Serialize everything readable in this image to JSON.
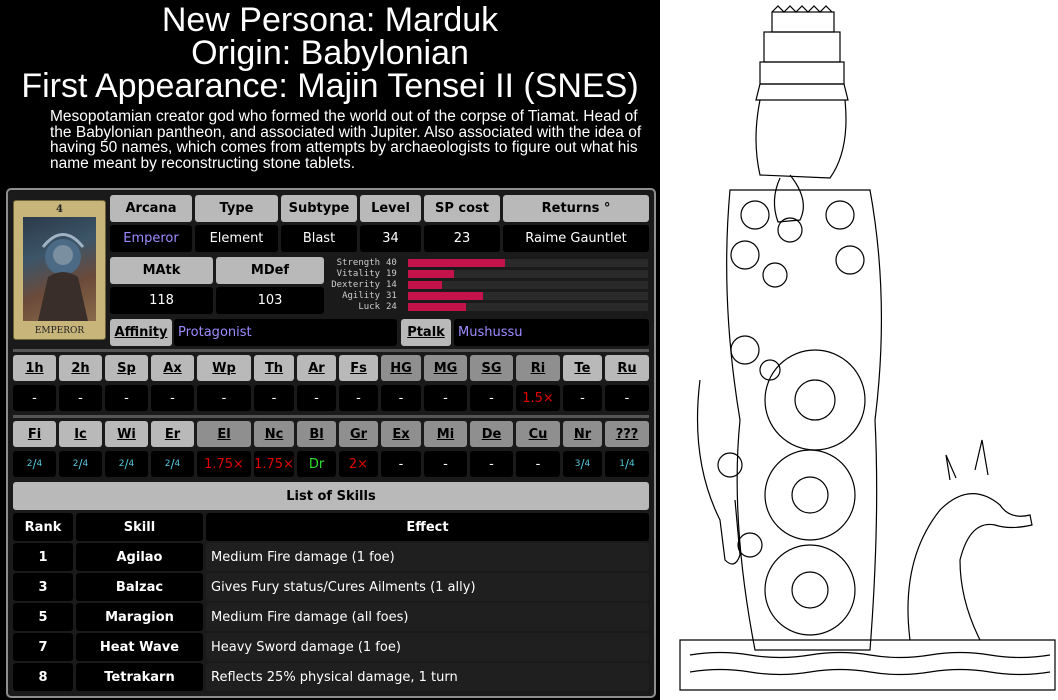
{
  "header": {
    "title": "New Persona: Marduk",
    "origin": "Origin: Babylonian",
    "first_appearance": "First Appearance: Majin Tensei II (SNES)",
    "description": "Mesopotamian creator god who formed the world out of the corpse of Tiamat. Head of the Babylonian pantheon, and associated with Jupiter. Also associated with the idea of having 50 names, which comes from attempts by archaeologists to figure out what his name meant by reconstructing stone tablets."
  },
  "card": {
    "number": "4",
    "label": "EMPEROR"
  },
  "info": {
    "headers": [
      "Arcana",
      "Type",
      "Subtype",
      "Level",
      "SP cost",
      "Returns °"
    ],
    "values": [
      "Emperor",
      "Element",
      "Blast",
      "34",
      "23",
      "Raime Gauntlet"
    ]
  },
  "combat": {
    "matk_label": "MAtk",
    "mdef_label": "MDef",
    "matk": "118",
    "mdef": "103"
  },
  "stats": [
    {
      "name": "Strength",
      "value": "40",
      "max": 99
    },
    {
      "name": "Vitality",
      "value": "19",
      "max": 99
    },
    {
      "name": "Dexterity",
      "value": "14",
      "max": 99
    },
    {
      "name": "Agility",
      "value": "31",
      "max": 99
    },
    {
      "name": "Luck",
      "value": "24",
      "max": 99
    }
  ],
  "affinity": {
    "label": "Affinity",
    "value": "Protagonist",
    "ptalk_label": "Ptalk",
    "ptalk_value": "Mushussu"
  },
  "resist_row1": {
    "headers": [
      "1h",
      "2h",
      "Sp",
      "Ax",
      "Wp",
      "Th",
      "Ar",
      "Fs",
      "HG",
      "MG",
      "SG",
      "Ri",
      "Te",
      "Ru"
    ],
    "values": [
      "-",
      "-",
      "-",
      "-",
      "-",
      "-",
      "-",
      "-",
      "-",
      "-",
      "-",
      "1.5×",
      "-",
      "-"
    ]
  },
  "resist_row2": {
    "headers": [
      "Fi",
      "Ic",
      "Wi",
      "Er",
      "El",
      "Nc",
      "Bl",
      "Gr",
      "Ex",
      "Mi",
      "De",
      "Cu",
      "Nr",
      "???"
    ],
    "values": [
      "2/4",
      "2/4",
      "2/4",
      "2/4",
      "1.75×",
      "1.75×",
      "Dr",
      "2×",
      "-",
      "-",
      "-",
      "-",
      "3/4",
      "1/4"
    ]
  },
  "skills": {
    "title": "List of Skills",
    "headers": [
      "Rank",
      "Skill",
      "Effect"
    ],
    "rows": [
      {
        "rank": "1",
        "skill": "Agilao",
        "effect": "Medium Fire damage (1 foe)"
      },
      {
        "rank": "3",
        "skill": "Balzac",
        "effect": "Gives Fury status/Cures Ailments (1 ally)"
      },
      {
        "rank": "5",
        "skill": "Maragion",
        "effect": "Medium Fire damage (all foes)"
      },
      {
        "rank": "7",
        "skill": "Heat Wave",
        "effect": "Heavy Sword damage (1 foe)"
      },
      {
        "rank": "8",
        "skill": "Tetrakarn",
        "effect": "Reflects 25% physical damage, 1 turn"
      }
    ]
  },
  "colors": {
    "weak": "#e00000",
    "drain": "#2ee02e",
    "fraction": "#56c6dc",
    "link": "#9f8bff",
    "stat_bar": "#c4124a"
  }
}
